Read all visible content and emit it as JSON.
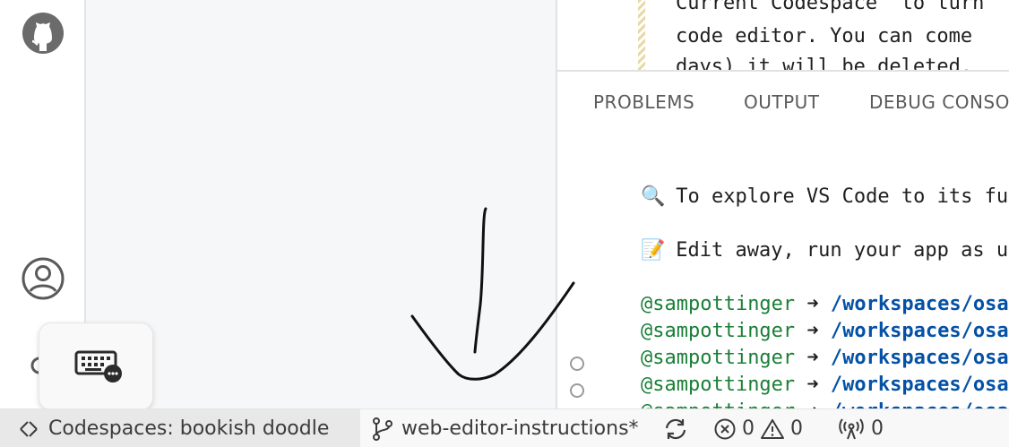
{
  "editor": {
    "lines": [
      "Current Codespace\" to turn",
      "code editor. You can come",
      "days) it will be deleted."
    ]
  },
  "panel": {
    "tabs": [
      "PROBLEMS",
      "OUTPUT",
      "DEBUG CONSOLE"
    ],
    "explore_text": "To explore VS Code to its fullest",
    "edit_text": "Edit away, run your app as usual",
    "prompt_user": "@sampottinger",
    "prompt_arrow": "➜",
    "prompt_path": "/workspaces/osaccess",
    "explore_emoji": "🔍",
    "edit_emoji": "📝"
  },
  "statusbar": {
    "remote_label": "Codespaces: bookish doodle",
    "branch": "web-editor-instructions*",
    "errors": "0",
    "warnings": "0",
    "ports": "0"
  },
  "icons": {
    "github": "github-icon",
    "account": "account-icon",
    "settings": "settings-gear-icon",
    "keyboard": "keyboard-icon",
    "remote": "remote-icon",
    "branch": "git-branch-icon",
    "sync": "sync-icon",
    "error": "error-icon",
    "warning": "warning-icon",
    "ports": "broadcast-icon"
  }
}
